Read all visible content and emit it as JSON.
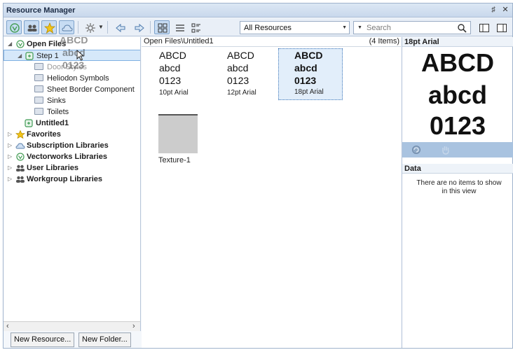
{
  "title": "Resource Manager",
  "window_buttons": {
    "pin": "♯",
    "close": "✕"
  },
  "toolbar": {
    "filter_value": "All Resources",
    "search_placeholder": "Search"
  },
  "tree": {
    "items": [
      {
        "label": "Open Files",
        "bold": true
      },
      {
        "label": "Step 1",
        "bold": false
      },
      {
        "label": "Door Styles",
        "bold": false
      },
      {
        "label": "Heliodon Symbols",
        "bold": false
      },
      {
        "label": "Sheet Border Component",
        "bold": false
      },
      {
        "label": "Sinks",
        "bold": false
      },
      {
        "label": "Toilets",
        "bold": false
      },
      {
        "label": "Untitled1",
        "bold": true
      },
      {
        "label": "Favorites",
        "bold": true
      },
      {
        "label": "Subscription Libraries",
        "bold": true
      },
      {
        "label": "Vectorworks Libraries",
        "bold": true
      },
      {
        "label": "User Libraries",
        "bold": true
      },
      {
        "label": "Workgroup Libraries",
        "bold": true
      }
    ],
    "drag_ghost": {
      "l1": "ABCD",
      "l2": "abcd",
      "l3": "0123"
    }
  },
  "buttons": {
    "new_resource": "New Resource...",
    "new_folder": "New Folder..."
  },
  "center": {
    "path": "Open Files\\Untitled1",
    "count": "(4 Items)",
    "tiles": [
      {
        "l1": "ABCD",
        "l2": "abcd",
        "l3": "0123",
        "caption": "10pt Arial"
      },
      {
        "l1": "ABCD",
        "l2": "abcd",
        "l3": "0123",
        "caption": "12pt Arial"
      },
      {
        "l1": "ABCD",
        "l2": "abcd",
        "l3": "0123",
        "caption": "18pt Arial"
      },
      {
        "caption": "Texture-1"
      }
    ]
  },
  "preview": {
    "title": "18pt Arial",
    "l1": "ABCD",
    "l2": "abcd",
    "l3": "0123"
  },
  "data_panel": {
    "title": "Data",
    "empty_message": "There are no items to show in this view"
  },
  "colors": {
    "accent": "#7fb0e2",
    "titlebar": "#c9d8ec",
    "preview_bar": "#a9c3e0"
  }
}
